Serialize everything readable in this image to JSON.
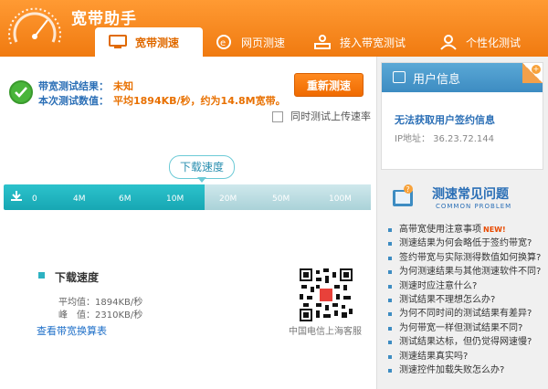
{
  "header": {
    "app_title": "宽带助手",
    "tabs": [
      {
        "label": "宽带测速",
        "icon": "monitor-icon",
        "active": true
      },
      {
        "label": "网页测速",
        "icon": "browser-icon",
        "active": false
      },
      {
        "label": "接入带宽测试",
        "icon": "connection-icon",
        "active": false
      },
      {
        "label": "个性化测试",
        "icon": "user-icon",
        "active": false
      }
    ]
  },
  "result": {
    "label_result": "带宽测试结果：",
    "value_result": "未知",
    "label_speed": "本次测试数值：",
    "value_speed": "平均1894KB/秒，约为14.8M宽带。",
    "retest_button": "重新测速",
    "upload_checkbox_label": "同时测试上传速率"
  },
  "meter": {
    "tag": "下载速度",
    "ticks": [
      "0",
      "4M",
      "6M",
      "10M",
      "20M",
      "50M",
      "100M"
    ]
  },
  "download": {
    "title": "下载速度",
    "avg": "平均值：1894KB/秒",
    "peak": "峰　值：2310KB/秒",
    "calc_link": "查看带宽换算表",
    "qr_caption": "中国电信上海客服"
  },
  "user_info": {
    "title": "用户信息",
    "message": "无法获取用户签约信息",
    "ip": "IP地址： 36.23.72.144"
  },
  "faq": {
    "title": "测速常见问题",
    "subtitle": "COMMON PROBLEM",
    "items": [
      "高带宽使用注意事项",
      "测速结果为何会略低于签约带宽?",
      "签约带宽与实际测得数值如何换算?",
      "为何测速结果与其他测速软件不同?",
      "测速时应注意什么?",
      "测试结果不理想怎么办?",
      "为何不同时间的测试结果有差异?",
      "为何带宽一样但测试结果不同?",
      "测试结果达标，但仍觉得网速慢?",
      "测速结果真实吗?",
      "测速控件加载失败怎么办?"
    ],
    "new_badge": "NEW!"
  },
  "colors": {
    "header_orange": "#f07a10",
    "accent_blue": "#2b6fb6",
    "meter_teal": "#17a7b3",
    "value_orange": "#e87000"
  }
}
